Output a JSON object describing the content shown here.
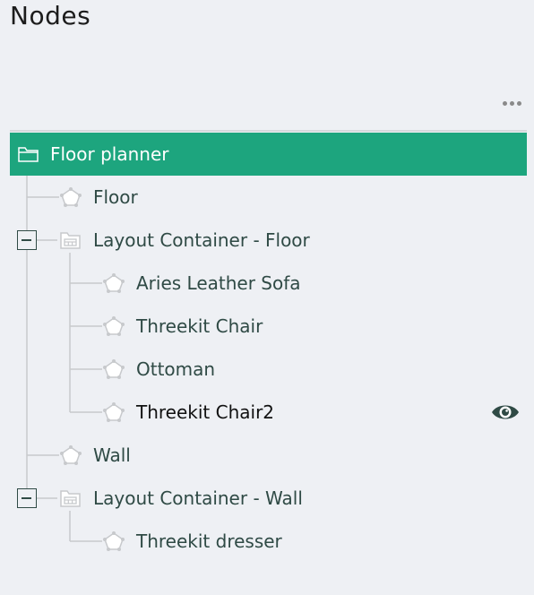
{
  "panel": {
    "title": "Nodes",
    "more_menu": "more-options"
  },
  "tree": {
    "root": {
      "label": "Floor planner",
      "icon": "folder-icon",
      "selected": true
    },
    "items": [
      {
        "label": "Floor",
        "icon": "node-icon"
      },
      {
        "label": "Layout Container - Floor",
        "icon": "layout-container-icon",
        "expanded": true
      },
      {
        "label": "Aries Leather Sofa",
        "icon": "node-icon"
      },
      {
        "label": "Threekit Chair",
        "icon": "node-icon"
      },
      {
        "label": "Ottoman",
        "icon": "node-icon"
      },
      {
        "label": "Threekit Chair2",
        "icon": "node-icon",
        "visibility_icon": "eye-icon"
      },
      {
        "label": "Wall",
        "icon": "node-icon"
      },
      {
        "label": "Layout Container - Wall",
        "icon": "layout-container-icon",
        "expanded": true
      },
      {
        "label": "Threekit dresser",
        "icon": "node-icon"
      }
    ]
  },
  "colors": {
    "selected_row": "#1da57e",
    "text": "#2f4a45",
    "tree_lines": "#c7c9cc",
    "background": "#eef0f4"
  }
}
